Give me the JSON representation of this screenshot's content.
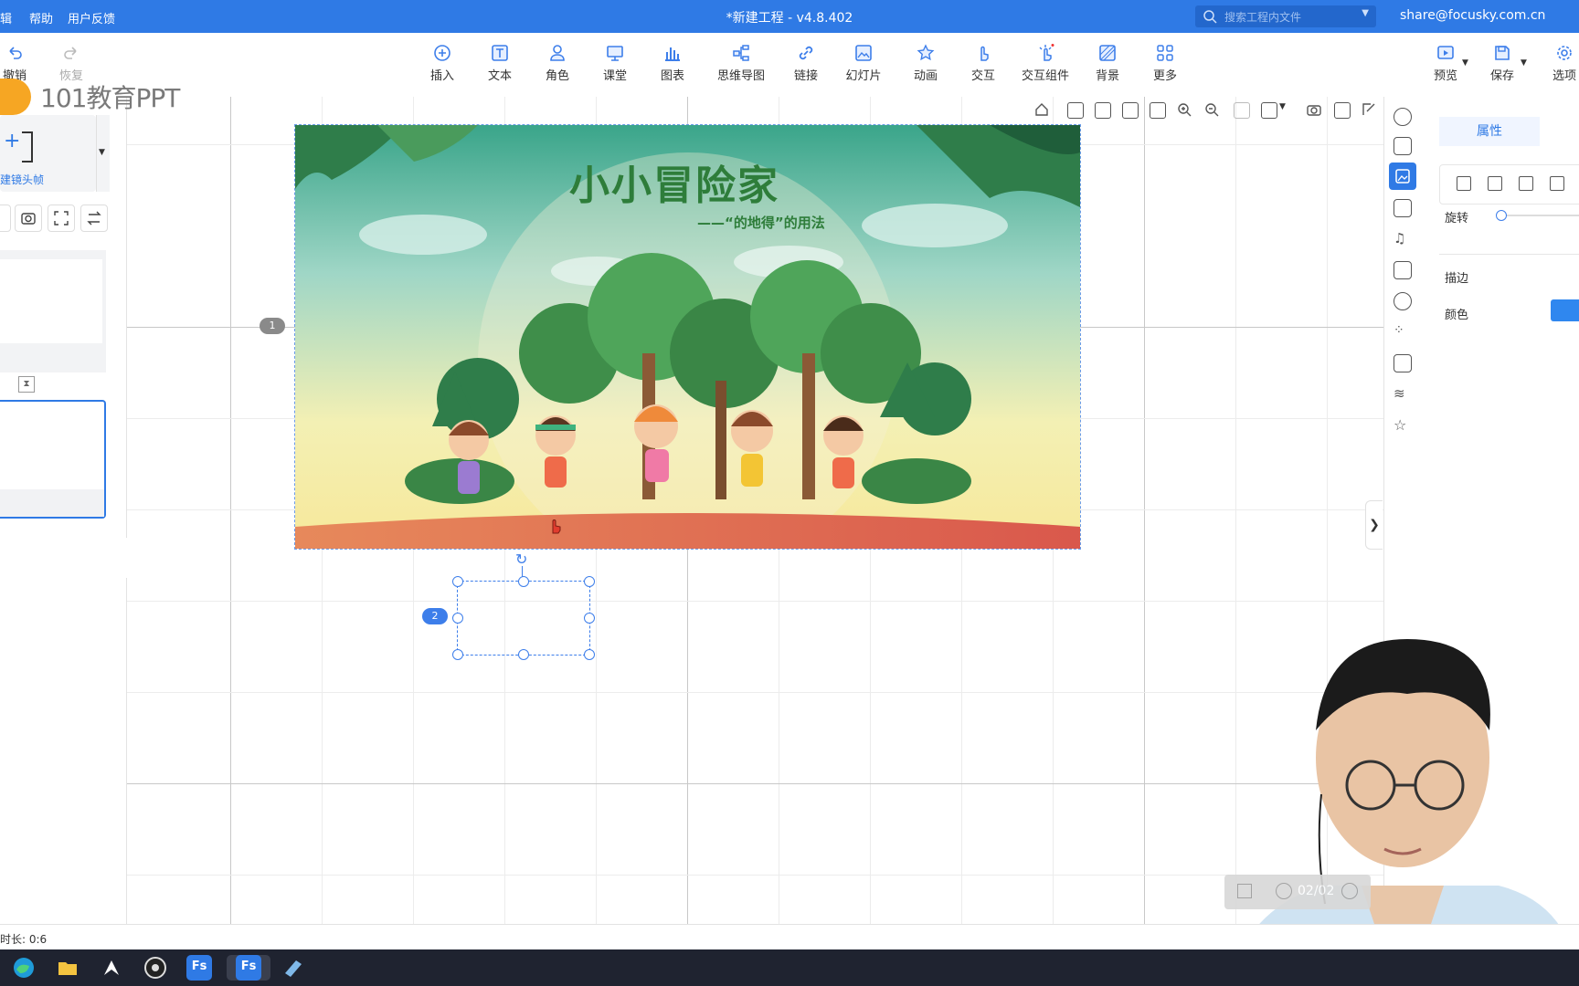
{
  "titlebar": {
    "menus": [
      "辑",
      "帮助",
      "用户反馈"
    ],
    "title": "*新建工程 - v4.8.402",
    "search_placeholder": "搜索工程内文件",
    "account": "share@focusky.com.cn"
  },
  "toolbar": {
    "undo": "撤销",
    "redo": "恢复",
    "items": [
      "插入",
      "文本",
      "角色",
      "课堂",
      "图表",
      "思维导图",
      "链接",
      "幻灯片",
      "动画",
      "交互",
      "交互组件",
      "背景",
      "更多"
    ],
    "right": [
      "预览",
      "保存",
      "选项"
    ]
  },
  "watermark": {
    "text": "101教育PPT"
  },
  "left_panel": {
    "add_frame_label": "建镜头帧"
  },
  "slide": {
    "title": "小小冒险家",
    "subtitle": "——“的地得”的用法"
  },
  "frames": {
    "badge1": "1",
    "badge2": "2"
  },
  "properties": {
    "tab": "属性",
    "rotate_label": "旋转",
    "stroke_label": "描边",
    "color_label": "颜色",
    "color_value": "#2f87ef"
  },
  "page_nav": {
    "page": "02/02"
  },
  "status": {
    "duration": "时长: 0:6"
  },
  "taskbar": {
    "apps": [
      "edge-icon",
      "explorer-icon",
      "app-icon",
      "obs-icon",
      "Fs",
      "Fs",
      "app-icon-2"
    ]
  }
}
